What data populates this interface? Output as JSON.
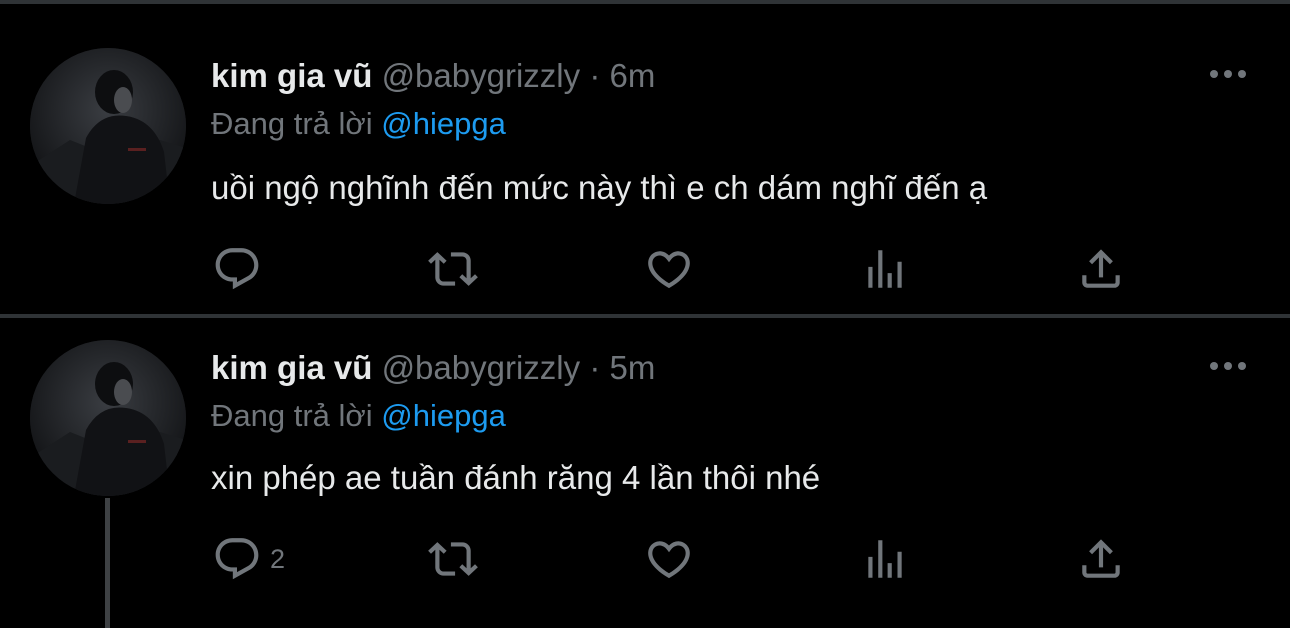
{
  "tweets": [
    {
      "name": "kim gia vũ",
      "handle": "@babygrizzly",
      "separator": "·",
      "time": "6m",
      "replying_prefix": "Đang trả lời",
      "replying_to": "@hiepga",
      "text": "uồi ngộ nghĩnh đến mức này thì e ch dám nghĩ đến ạ",
      "reply_count": "",
      "has_thread_line": false
    },
    {
      "name": "kim gia vũ",
      "handle": "@babygrizzly",
      "separator": "·",
      "time": "5m",
      "replying_prefix": "Đang trả lời",
      "replying_to": "@hiepga",
      "text": "xin phép ae tuần đánh răng 4 lần thôi nhé",
      "reply_count": "2",
      "has_thread_line": true
    }
  ],
  "icons": {
    "reply": "reply-icon",
    "retweet": "retweet-icon",
    "like": "heart-icon",
    "views": "analytics-icon",
    "share": "share-icon",
    "more": "more-icon"
  },
  "colors": {
    "background": "#000000",
    "text_primary": "#e7e9ea",
    "text_secondary": "#71767b",
    "mention": "#1d9bf0",
    "divider": "#2f3336"
  }
}
